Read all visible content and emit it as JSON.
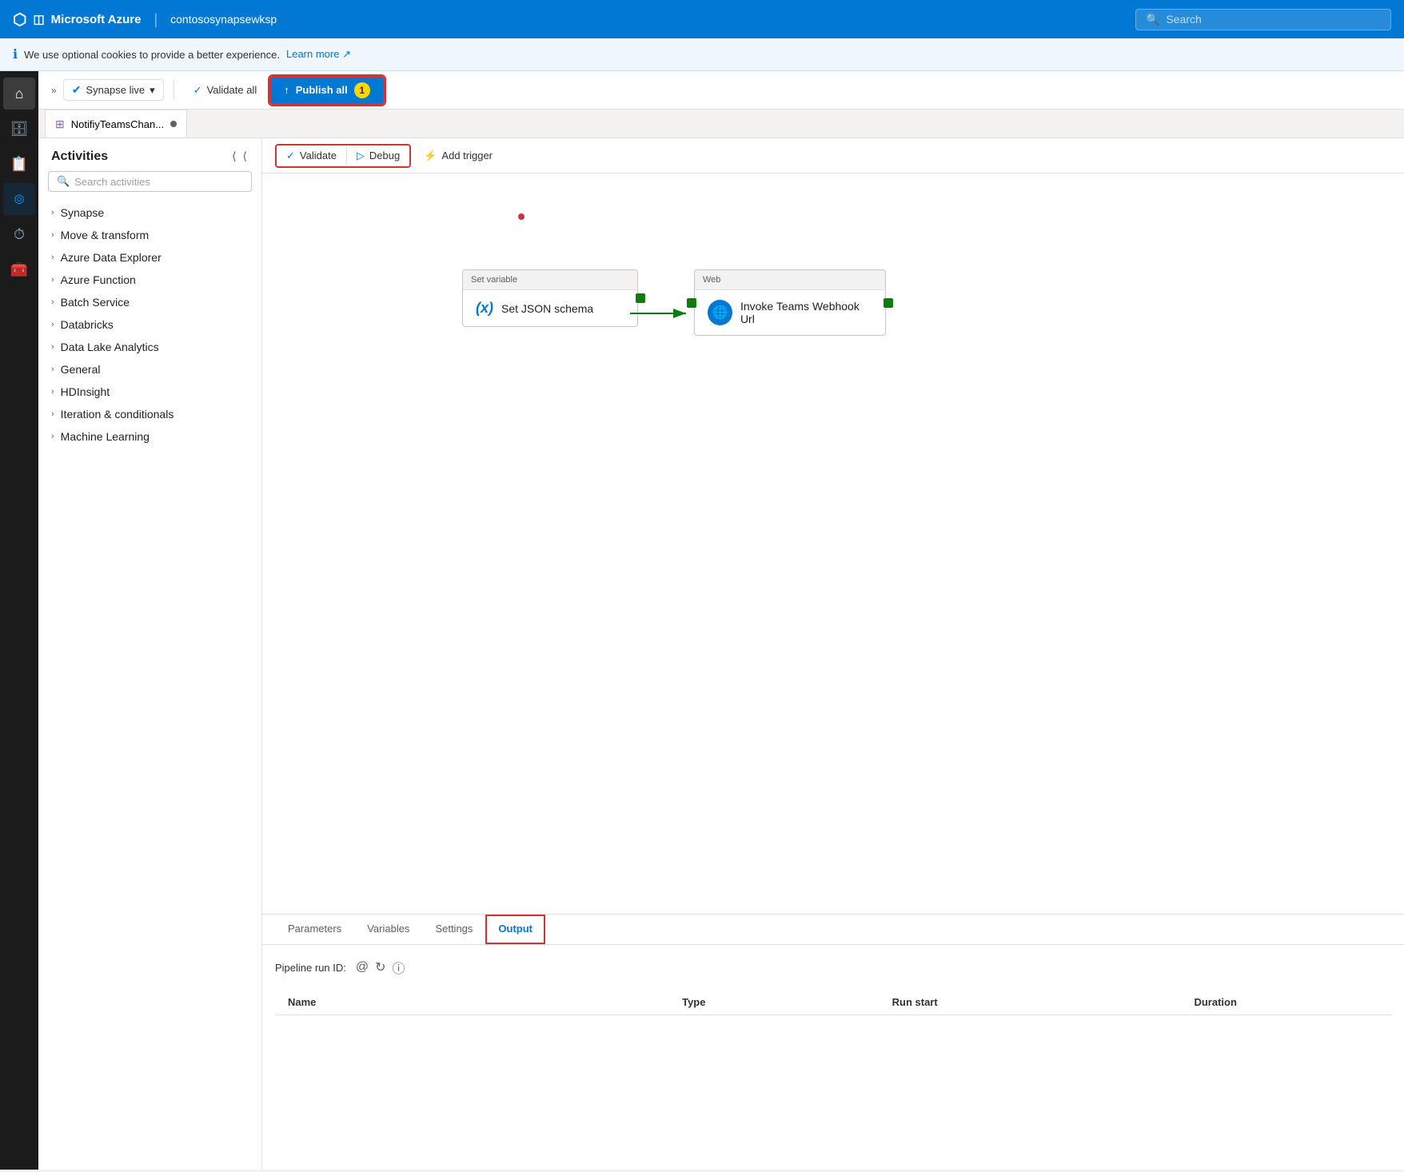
{
  "app": {
    "title": "Microsoft Azure",
    "workspace": "contososynapsewksp"
  },
  "topbar": {
    "logo": "⬡",
    "title": "Microsoft Azure",
    "workspace": "contososynapsewksp",
    "search_placeholder": "Search",
    "divider": "|"
  },
  "cookie_banner": {
    "text": "We use optional cookies to provide a better experience.",
    "link_text": "Learn more",
    "info_icon": "ℹ"
  },
  "toolbar": {
    "expand_icon": "»",
    "synapse_live_label": "Synapse live",
    "validate_label": "Validate all",
    "publish_all_label": "Publish all",
    "publish_badge": "1"
  },
  "pipeline_tab": {
    "icon": "⊞",
    "label": "NotifiyTeamsChan...",
    "dot": ""
  },
  "canvas_toolbar": {
    "validate_label": "Validate",
    "debug_label": "Debug",
    "add_trigger_label": "Add trigger"
  },
  "activities": {
    "title": "Activities",
    "search_placeholder": "Search activities",
    "groups": [
      {
        "label": "Synapse"
      },
      {
        "label": "Move & transform"
      },
      {
        "label": "Azure Data Explorer"
      },
      {
        "label": "Azure Function"
      },
      {
        "label": "Batch Service"
      },
      {
        "label": "Databricks"
      },
      {
        "label": "Data Lake Analytics"
      },
      {
        "label": "General"
      },
      {
        "label": "HDInsight"
      },
      {
        "label": "Iteration & conditionals"
      },
      {
        "label": "Machine Learning"
      }
    ]
  },
  "nodes": {
    "set_variable": {
      "header": "Set variable",
      "label": "Set JSON schema",
      "icon": "(x)"
    },
    "web": {
      "header": "Web",
      "label": "Invoke Teams Webhook Url",
      "icon": "🌐"
    }
  },
  "bottom_panel": {
    "tabs": [
      {
        "label": "Parameters"
      },
      {
        "label": "Variables"
      },
      {
        "label": "Settings"
      },
      {
        "label": "Output",
        "active": true
      }
    ],
    "pipeline_run_label": "Pipeline run ID:",
    "table_headers": {
      "name": "Name",
      "type": "Type",
      "run_start": "Run start",
      "duration": "Duration"
    }
  },
  "left_nav": {
    "icons": [
      {
        "name": "home-icon",
        "glyph": "⌂",
        "active": true
      },
      {
        "name": "database-icon",
        "glyph": "🗄"
      },
      {
        "name": "document-icon",
        "glyph": "📄"
      },
      {
        "name": "pipeline-icon",
        "glyph": "◎"
      },
      {
        "name": "monitor-icon",
        "glyph": "⏱"
      },
      {
        "name": "briefcase-icon",
        "glyph": "💼"
      }
    ]
  }
}
